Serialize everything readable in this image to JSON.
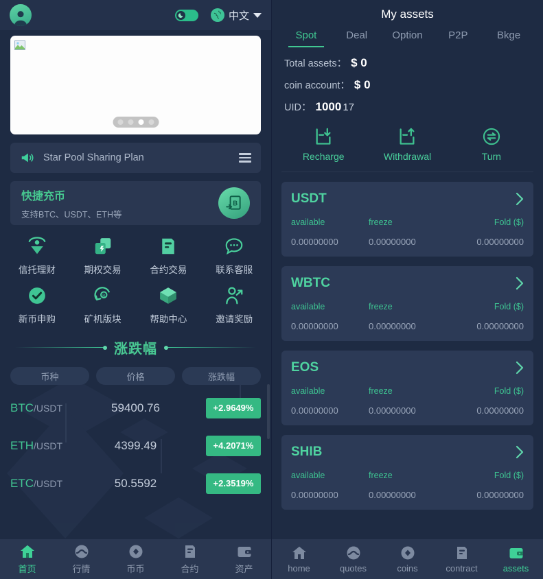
{
  "left": {
    "header": {
      "avatar": "user-avatar",
      "theme_toggle": "dark-mode-toggle",
      "language": "中文",
      "globe_icon": "globe-icon"
    },
    "carousel": {
      "dot_count": 4,
      "active_dot": 3
    },
    "notice": {
      "icon": "megaphone-icon",
      "text": "Star Pool Sharing Plan",
      "menu_icon": "hamburger-icon"
    },
    "quick_recharge": {
      "title": "快捷充币",
      "subtitle": "支持BTC、USDT、ETH等",
      "badge_icon": "bitcoin-deposit-icon"
    },
    "menu": [
      {
        "label": "信托理财",
        "icon": "trust-finance-icon"
      },
      {
        "label": "期权交易",
        "icon": "option-trade-icon"
      },
      {
        "label": "合约交易",
        "icon": "contract-trade-icon"
      },
      {
        "label": "联系客服",
        "icon": "customer-service-icon"
      },
      {
        "label": "新币申购",
        "icon": "new-coin-icon"
      },
      {
        "label": "矿机版块",
        "icon": "mining-icon"
      },
      {
        "label": "帮助中心",
        "icon": "help-center-icon"
      },
      {
        "label": "邀请奖励",
        "icon": "invite-reward-icon"
      }
    ],
    "market": {
      "title": "涨跌幅",
      "columns": [
        "币种",
        "价格",
        "涨跌幅"
      ],
      "rows": [
        {
          "base": "BTC",
          "quote": "/USDT",
          "price": "59400.76",
          "change": "+2.9649%"
        },
        {
          "base": "ETH",
          "quote": "/USDT",
          "price": "4399.49",
          "change": "+4.2071%"
        },
        {
          "base": "ETC",
          "quote": "/USDT",
          "price": "50.5592",
          "change": "+2.3519%"
        }
      ]
    },
    "nav": [
      {
        "label": "首页",
        "icon": "home-icon",
        "active": true
      },
      {
        "label": "行情",
        "icon": "quotes-icon",
        "active": false
      },
      {
        "label": "币币",
        "icon": "coins-icon",
        "active": false
      },
      {
        "label": "合约",
        "icon": "contract-icon",
        "active": false
      },
      {
        "label": "资产",
        "icon": "assets-wallet-icon",
        "active": false
      }
    ]
  },
  "right": {
    "title": "My assets",
    "tabs": [
      {
        "label": "Spot",
        "active": true
      },
      {
        "label": "Deal",
        "active": false
      },
      {
        "label": "Option",
        "active": false
      },
      {
        "label": "P2P",
        "active": false
      },
      {
        "label": "Bkge",
        "active": false
      }
    ],
    "info": {
      "total_assets_label": "Total assets：",
      "total_assets_value": "$ 0",
      "coin_account_label": "coin account：",
      "coin_account_value": "$ 0",
      "uid_label": "UID：",
      "uid_value": "1000",
      "uid_suffix": "17"
    },
    "actions": [
      {
        "label": "Recharge",
        "icon": "recharge-icon"
      },
      {
        "label": "Withdrawal",
        "icon": "withdrawal-icon"
      },
      {
        "label": "Turn",
        "icon": "transfer-icon"
      }
    ],
    "asset_columns": [
      "available",
      "freeze",
      "Fold ($)"
    ],
    "assets": [
      {
        "symbol": "USDT",
        "available": "0.00000000",
        "freeze": "0.00000000",
        "fold": "0.00000000"
      },
      {
        "symbol": "WBTC",
        "available": "0.00000000",
        "freeze": "0.00000000",
        "fold": "0.00000000"
      },
      {
        "symbol": "EOS",
        "available": "0.00000000",
        "freeze": "0.00000000",
        "fold": "0.00000000"
      },
      {
        "symbol": "SHIB",
        "available": "0.00000000",
        "freeze": "0.00000000",
        "fold": "0.00000000"
      }
    ],
    "nav": [
      {
        "label": "home",
        "icon": "home-icon",
        "active": false
      },
      {
        "label": "quotes",
        "icon": "quotes-icon",
        "active": false
      },
      {
        "label": "coins",
        "icon": "coins-icon",
        "active": false
      },
      {
        "label": "contract",
        "icon": "contract-icon",
        "active": false
      },
      {
        "label": "assets",
        "icon": "assets-wallet-icon",
        "active": true
      }
    ]
  },
  "colors": {
    "background": "#1e2b43",
    "card": "#2c3a56",
    "accent_green": "#41c892",
    "pill_green": "#35b983",
    "muted_text": "#8e9bb0"
  }
}
